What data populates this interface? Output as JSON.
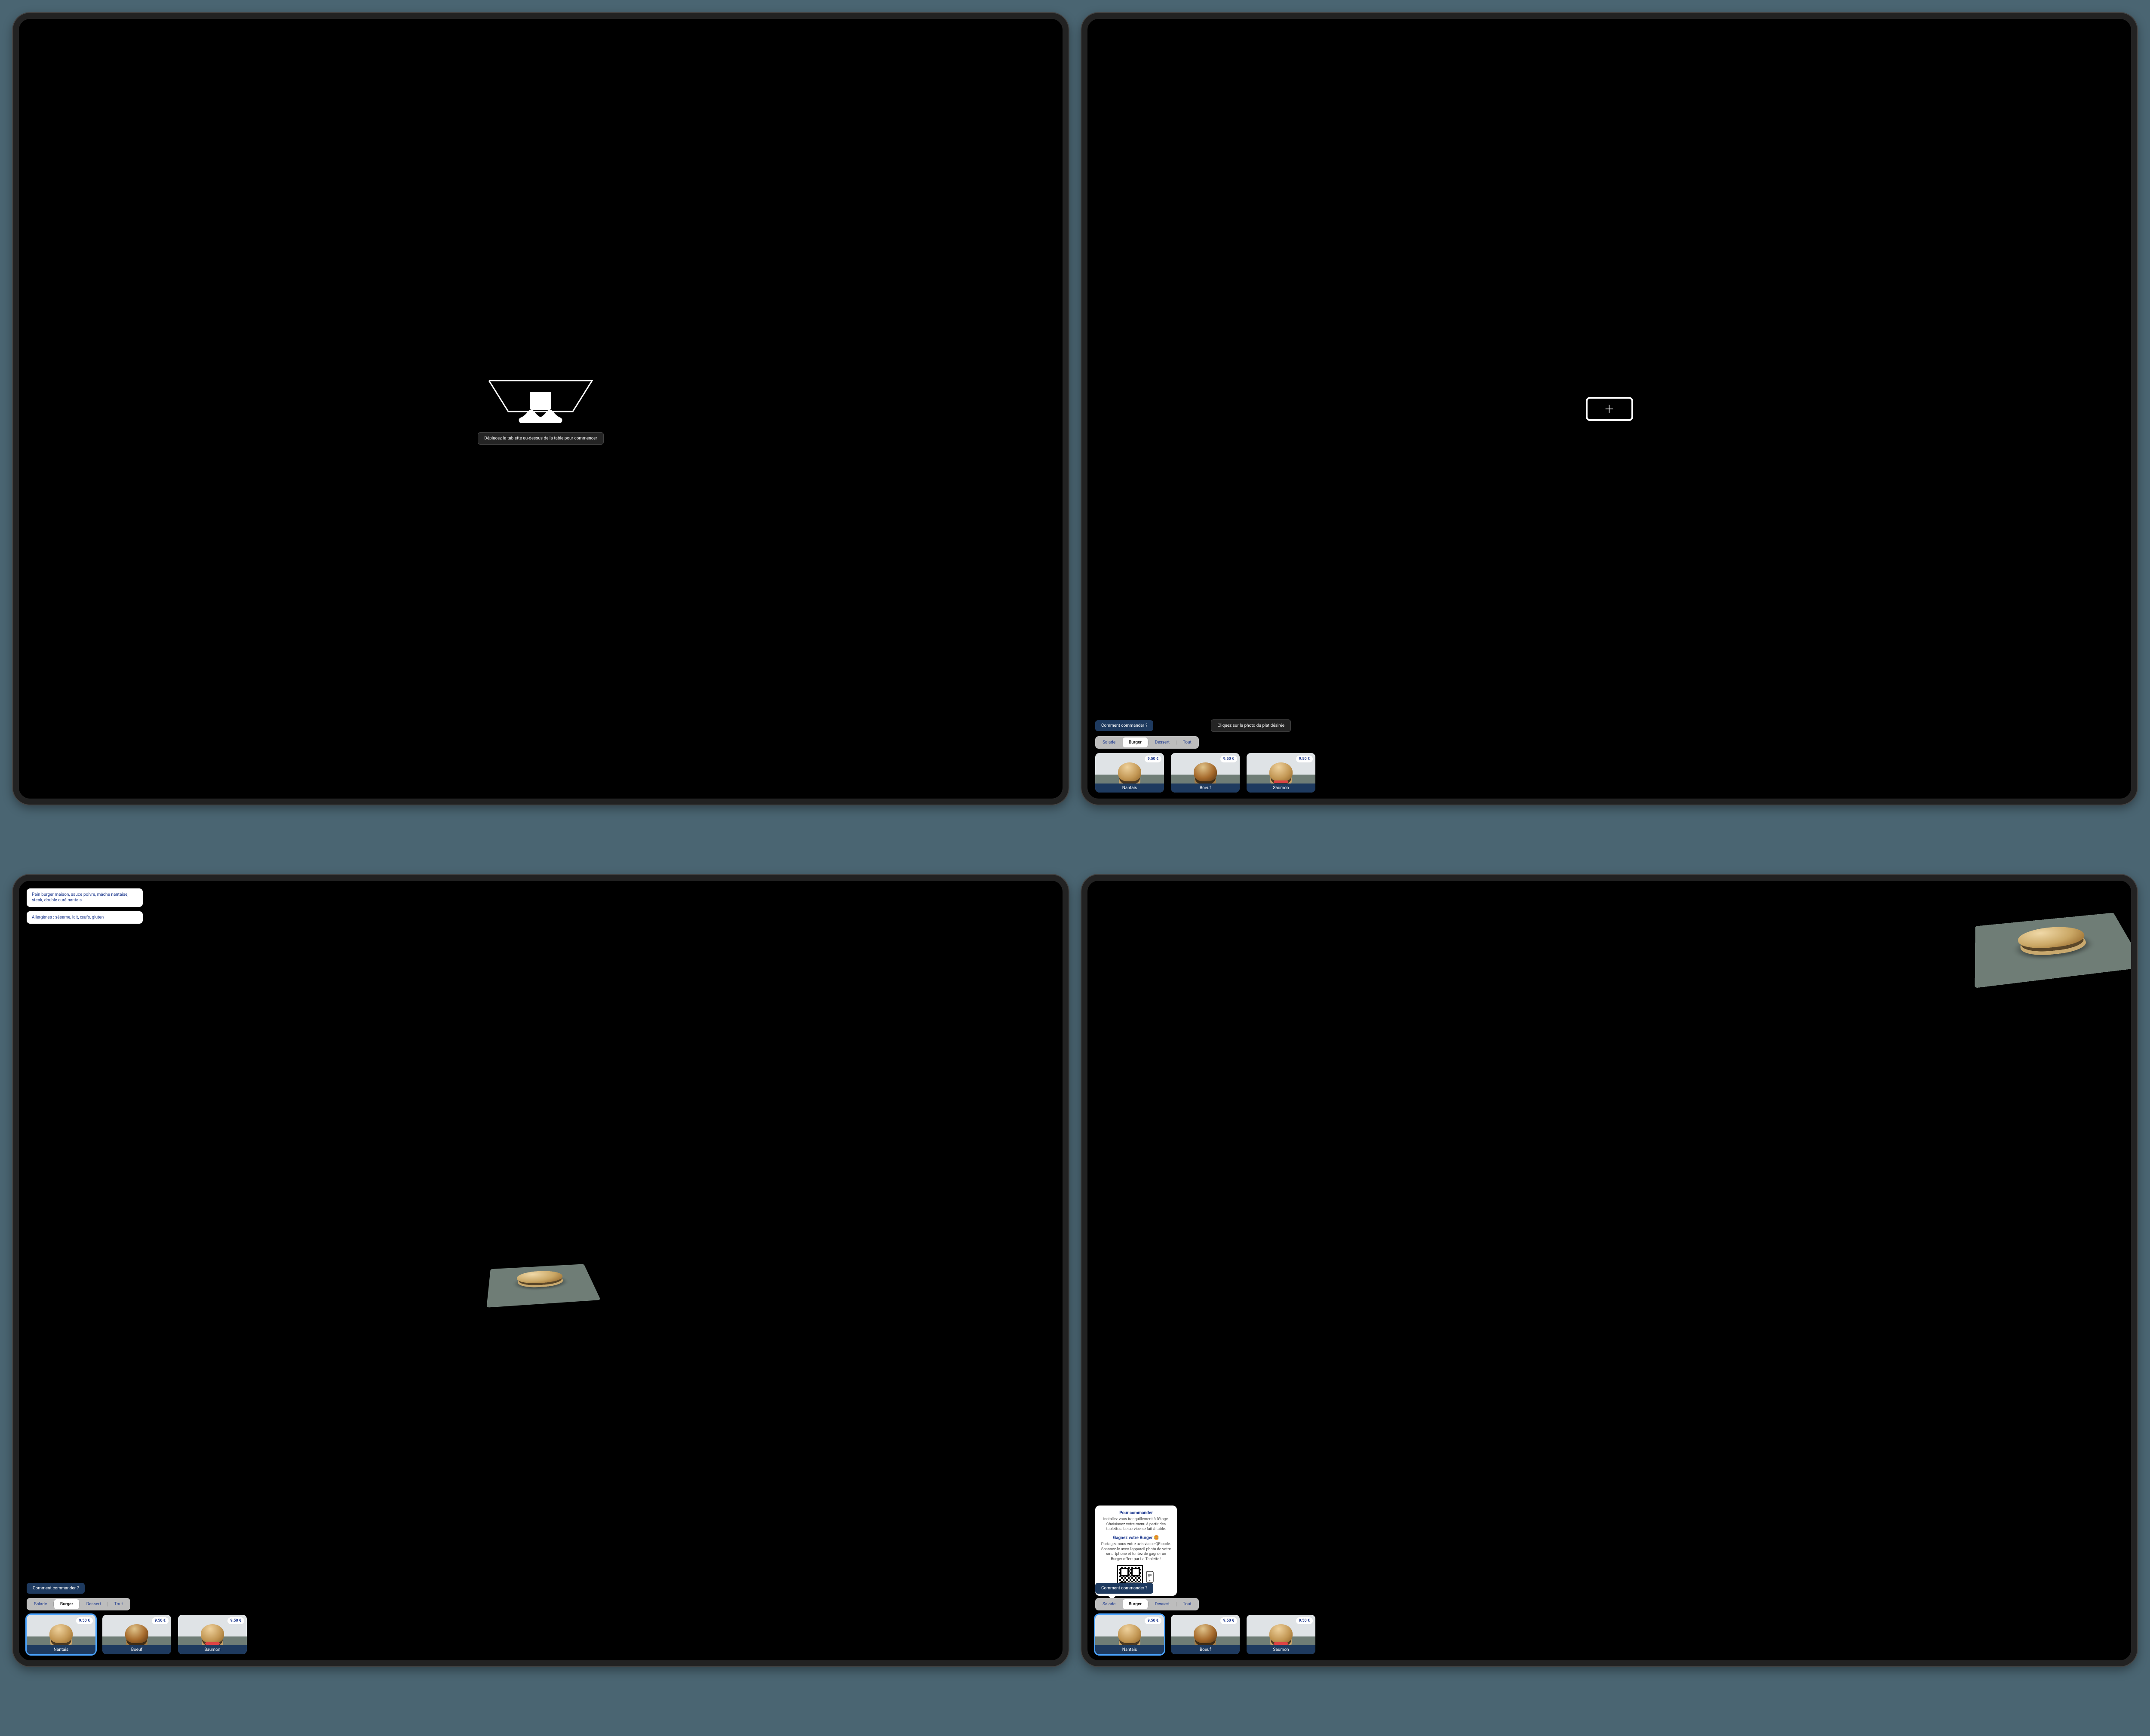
{
  "screens": {
    "s1": {
      "instruction": "Déplacez la tablette au-dessus de la table pour commencer"
    },
    "s2": {
      "howto_label": "Comment commander ?",
      "click_hint": "Cliquez sur la photo du plat désirée"
    },
    "s3": {
      "howto_label": "Comment commander ?",
      "ingredients": "Pain burger maison, sauce poivre, mâche nantaise, steak, double curé nantais",
      "allergens": "Allergènes : sésame, lait, œufs, gluten"
    },
    "s4": {
      "howto_label": "Comment commander ?",
      "popover": {
        "title1": "Pour commander",
        "body1": "Installez-vous tranquillement à l'étage. Choisissez votre menu à partir des tablettes. Le service se fait à table.",
        "title2": "Gagnez votre Burger 🍔",
        "body2": "Partagez-nous votre avis via ce QR code. Scannez-le avec l'appareil photo de votre smartphone et tentez de gagner un Burger offert par La Tablette !"
      }
    }
  },
  "categories": {
    "items": [
      "Salade",
      "Burger",
      "Dessert",
      "Tout"
    ],
    "active_index": 1
  },
  "menu": {
    "items": [
      {
        "name": "Nantais",
        "price": "9.50 €",
        "selected": true,
        "variant": "plain"
      },
      {
        "name": "Boeuf",
        "price": "9.50 €",
        "selected": false,
        "variant": "dk"
      },
      {
        "name": "Saumon",
        "price": "9.50 €",
        "selected": false,
        "variant": "sal"
      }
    ]
  }
}
